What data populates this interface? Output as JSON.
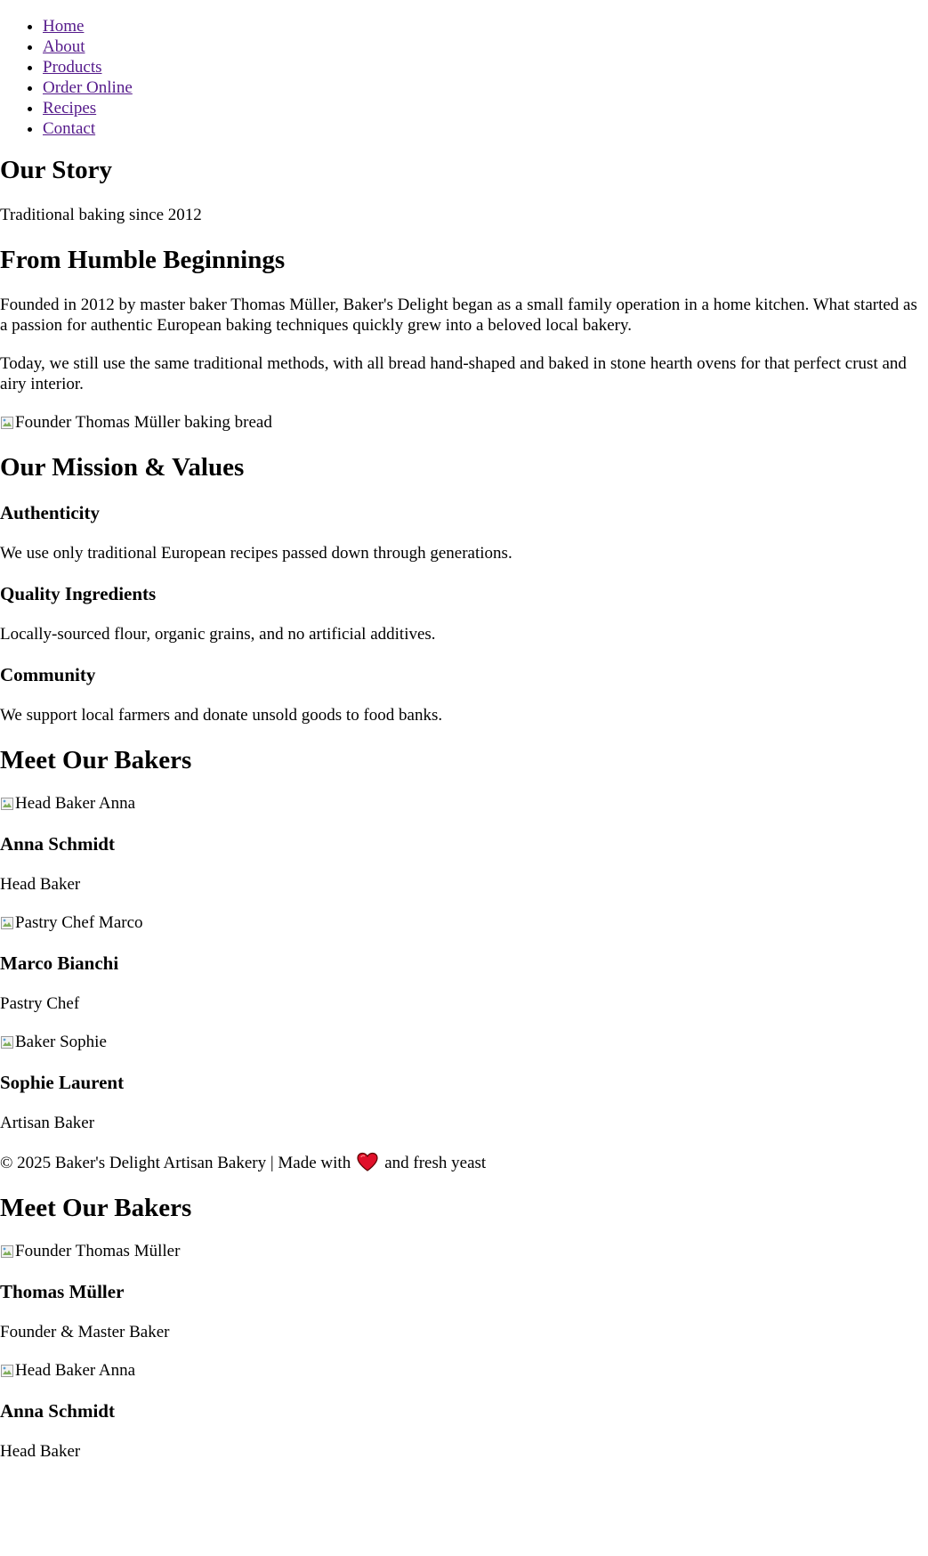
{
  "nav": {
    "items": [
      {
        "label": "Home"
      },
      {
        "label": "About"
      },
      {
        "label": "Products"
      },
      {
        "label": "Order Online"
      },
      {
        "label": "Recipes"
      },
      {
        "label": "Contact"
      }
    ],
    "link_color": "#551a8b"
  },
  "hero": {
    "title": "Our Story",
    "tagline": "Traditional baking since 2012"
  },
  "history": {
    "title": "From Humble Beginnings",
    "paragraph1": "Founded in 2012 by master baker Thomas Müller, Baker's Delight began as a small family operation in a home kitchen. What started as a passion for authentic European baking techniques quickly grew into a beloved local bakery.",
    "paragraph2": "Today, we still use the same traditional methods, with all bread hand-shaped and baked in stone hearth ovens for that perfect crust and airy interior.",
    "image_alt": "Founder Thomas Müller baking bread"
  },
  "values": {
    "title": "Our Mission & Values",
    "items": [
      {
        "title": "Authenticity",
        "text": "We use only traditional European recipes passed down through generations."
      },
      {
        "title": "Quality Ingredients",
        "text": "Locally-sourced flour, organic grains, and no artificial additives."
      },
      {
        "title": "Community",
        "text": "We support local farmers and donate unsold goods to food banks."
      }
    ]
  },
  "team": {
    "title": "Meet Our Bakers",
    "members": [
      {
        "image_alt": "Head Baker Anna",
        "name": "Anna Schmidt",
        "role": "Head Baker"
      },
      {
        "image_alt": "Pastry Chef Marco",
        "name": "Marco Bianchi",
        "role": "Pastry Chef"
      },
      {
        "image_alt": "Baker Sophie",
        "name": "Sophie Laurent",
        "role": "Artisan Baker"
      }
    ]
  },
  "footer": {
    "text_before": "© 2025 Baker's Delight Artisan Bakery | Made with",
    "icon": "heart-icon",
    "text_after": "and fresh yeast",
    "heart_color": "#e0102a"
  },
  "team2": {
    "title": "Meet Our Bakers",
    "members": [
      {
        "image_alt": "Founder Thomas Müller",
        "name": "Thomas Müller",
        "role": "Founder & Master Baker"
      },
      {
        "image_alt": "Head Baker Anna",
        "name": "Anna Schmidt",
        "role": "Head Baker"
      }
    ]
  }
}
